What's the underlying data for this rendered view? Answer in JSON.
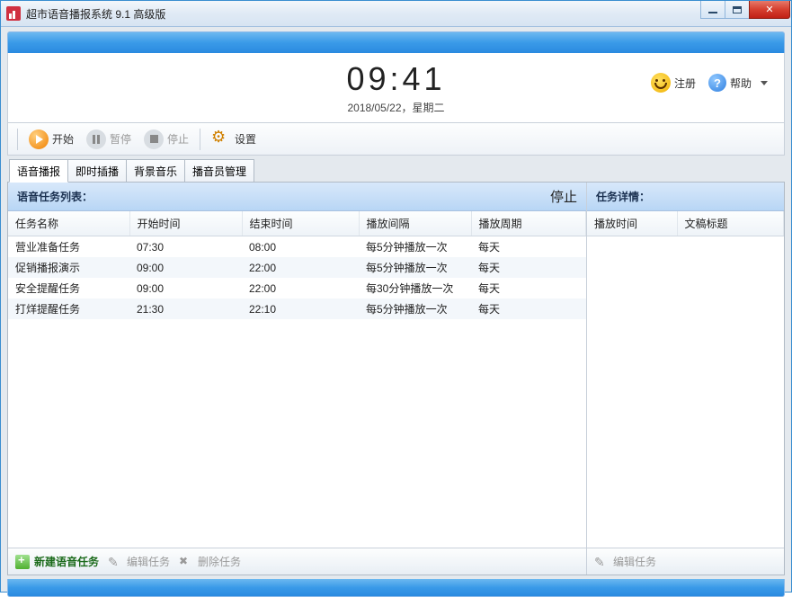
{
  "window": {
    "title": "超市语音播报系统 9.1 高级版"
  },
  "clock": {
    "time": "09:41",
    "date": "2018/05/22，星期二"
  },
  "header_right": {
    "register": "注册",
    "help": "帮助"
  },
  "toolbar": {
    "start": "开始",
    "pause": "暂停",
    "stop": "停止",
    "settings": "设置"
  },
  "tabs": [
    "语音播报",
    "即时插播",
    "背景音乐",
    "播音员管理"
  ],
  "left": {
    "title": "语音任务列表：",
    "status": "停止",
    "columns": [
      "任务名称",
      "开始时间",
      "结束时间",
      "播放间隔",
      "播放周期"
    ],
    "rows": [
      {
        "c0": "营业准备任务",
        "c1": "07:30",
        "c2": "08:00",
        "c3": "每5分钟播放一次",
        "c4": "每天"
      },
      {
        "c0": "促销播报演示",
        "c1": "09:00",
        "c2": "22:00",
        "c3": "每5分钟播放一次",
        "c4": "每天"
      },
      {
        "c0": "安全提醒任务",
        "c1": "09:00",
        "c2": "22:00",
        "c3": "每30分钟播放一次",
        "c4": "每天"
      },
      {
        "c0": "打烊提醒任务",
        "c1": "21:30",
        "c2": "22:10",
        "c3": "每5分钟播放一次",
        "c4": "每天"
      }
    ],
    "footer": {
      "new": "新建语音任务",
      "edit": "编辑任务",
      "del": "删除任务"
    }
  },
  "right": {
    "title": "任务详情：",
    "columns": [
      "播放时间",
      "文稿标题"
    ],
    "footer": {
      "edit": "编辑任务"
    }
  }
}
